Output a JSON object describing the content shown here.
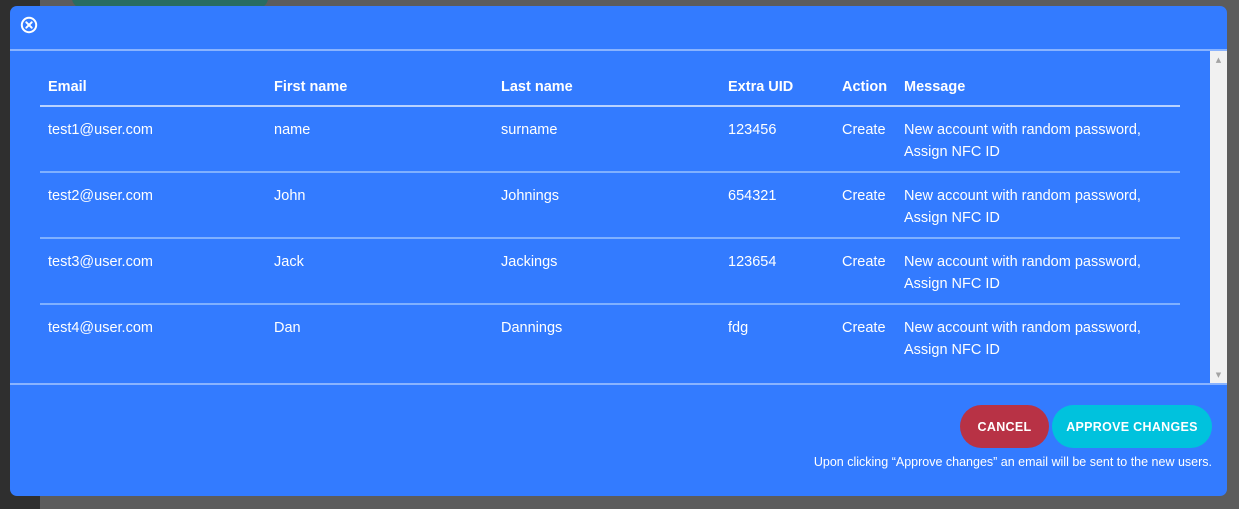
{
  "modal": {
    "close_icon": "close-circle-icon",
    "colors": {
      "background": "#337bff",
      "cancel": "#b83245",
      "approve": "#00c2dd"
    }
  },
  "table": {
    "columns": [
      "Email",
      "First name",
      "Last name",
      "Extra UID",
      "Action",
      "Message"
    ],
    "rows": [
      {
        "email": "test1@user.com",
        "first_name": "name",
        "last_name": "surname",
        "extra_uid": "123456",
        "action": "Create",
        "message": "New account with random password, Assign NFC ID"
      },
      {
        "email": "test2@user.com",
        "first_name": "John",
        "last_name": "Johnings",
        "extra_uid": "654321",
        "action": "Create",
        "message": "New account with random password, Assign NFC ID"
      },
      {
        "email": "test3@user.com",
        "first_name": "Jack",
        "last_name": "Jackings",
        "extra_uid": "123654",
        "action": "Create",
        "message": "New account with random password, Assign NFC ID"
      },
      {
        "email": "test4@user.com",
        "first_name": "Dan",
        "last_name": "Dannings",
        "extra_uid": "fdg",
        "action": "Create",
        "message": "New account with random password, Assign NFC ID"
      }
    ]
  },
  "footer": {
    "cancel_label": "CANCEL",
    "approve_label": "APPROVE CHANGES",
    "notice": "Upon clicking “Approve changes” an email will be sent to the new users."
  }
}
